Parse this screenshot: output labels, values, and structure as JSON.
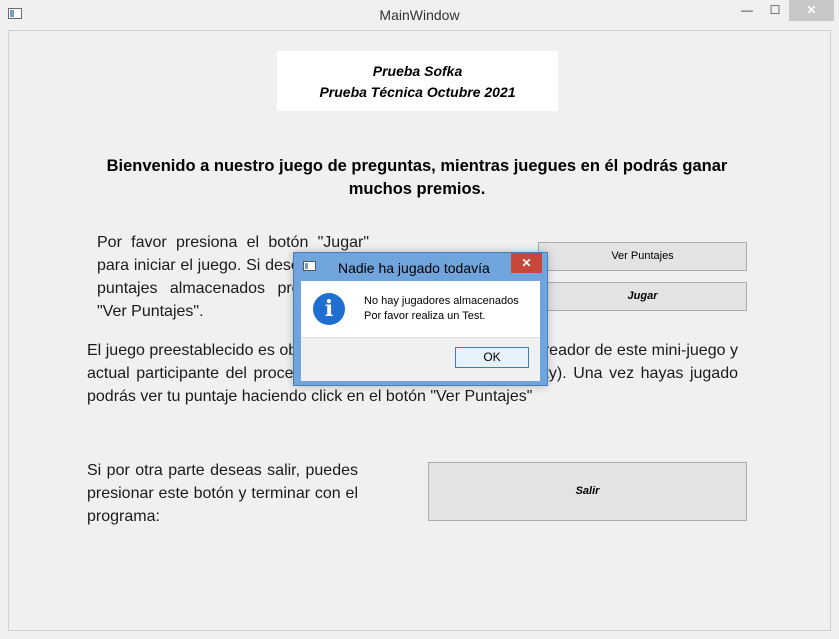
{
  "window": {
    "title": "MainWindow",
    "minimize": "—",
    "maximize": "☐",
    "close": "✕"
  },
  "header": {
    "line1": "Prueba Sofka",
    "line2": "Prueba Técnica Octubre 2021"
  },
  "welcome": "Bienvenido a nuestro juego de preguntas, mientras juegues en él podrás ganar muchos premios.",
  "instructions": {
    "play": "Por favor presiona el botón \"Jugar\" para iniciar el juego. Si deseas ver los puntajes almacenados presiona en \"Ver Puntajes\".",
    "description": "El juego preestablecido es obra de David Leonardo Contreras (creador de este mini-juego y actual participante del proceso de selección de Sofka University). Una vez hayas jugado podrás ver tu puntaje haciendo click en el botón \"Ver Puntajes\"",
    "exit": "Si por otra parte deseas salir, puedes presionar este botón y terminar con el programa:"
  },
  "buttons": {
    "ver_puntajes": "Ver Puntajes",
    "jugar": "Jugar",
    "salir": "Salir"
  },
  "dialog": {
    "title": "Nadie ha jugado todavía",
    "close": "✕",
    "icon": "information-icon",
    "icon_glyph": "i",
    "message_line1": "No hay jugadores almacenados",
    "message_line2": "Por favor realiza un Test.",
    "ok_label": "OK"
  }
}
